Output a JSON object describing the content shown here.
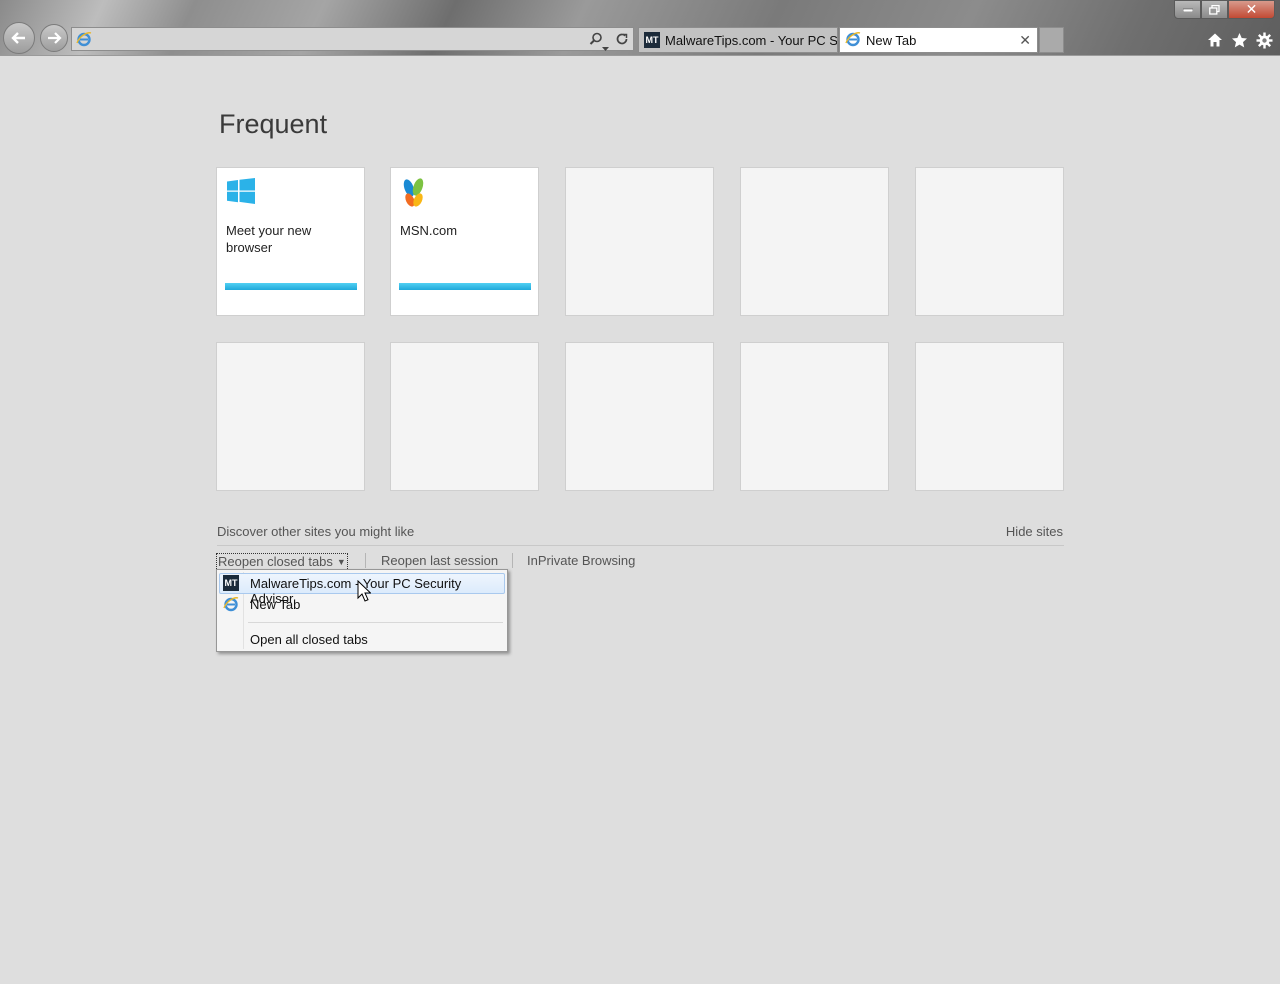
{
  "window": {
    "controls": {
      "minimize_icon": "minimize-icon",
      "maximize_icon": "restore-icon",
      "close_icon": "close-icon"
    }
  },
  "navigation": {
    "back_icon": "back-arrow-icon",
    "forward_icon": "forward-arrow-icon",
    "address_value": "",
    "address_icon": "ie-logo-icon"
  },
  "tabs": [
    {
      "title": "MalwareTips.com - Your PC Se...",
      "icon": "mt-icon",
      "active": false
    },
    {
      "title": "New Tab",
      "icon": "ie-logo-icon",
      "active": true
    }
  ],
  "toolbar": {
    "home_icon": "home-icon",
    "favorites_icon": "star-icon",
    "tools_icon": "gear-icon"
  },
  "frequent": {
    "heading": "Frequent",
    "tiles": [
      {
        "label": "Meet your new browser",
        "icon": "windows-logo-icon"
      },
      {
        "label": "MSN.com",
        "icon": "msn-butterfly-icon"
      }
    ]
  },
  "footer": {
    "discover": "Discover other sites you might like",
    "hide_sites": "Hide sites",
    "reopen_closed_tabs": "Reopen closed tabs",
    "reopen_last_session": "Reopen last session",
    "inprivate": "InPrivate Browsing"
  },
  "menu": {
    "items": [
      {
        "label": "MalwareTips.com - Your PC Security Advisor",
        "icon": "mt-icon",
        "highlighted": true
      },
      {
        "label": "New Tab",
        "icon": "ie-logo-icon"
      }
    ],
    "open_all": "Open all closed tabs"
  },
  "colors": {
    "accent_bar": "#1fa9da",
    "page_bg": "#dedede",
    "menu_highlight": "#dcebfc"
  }
}
